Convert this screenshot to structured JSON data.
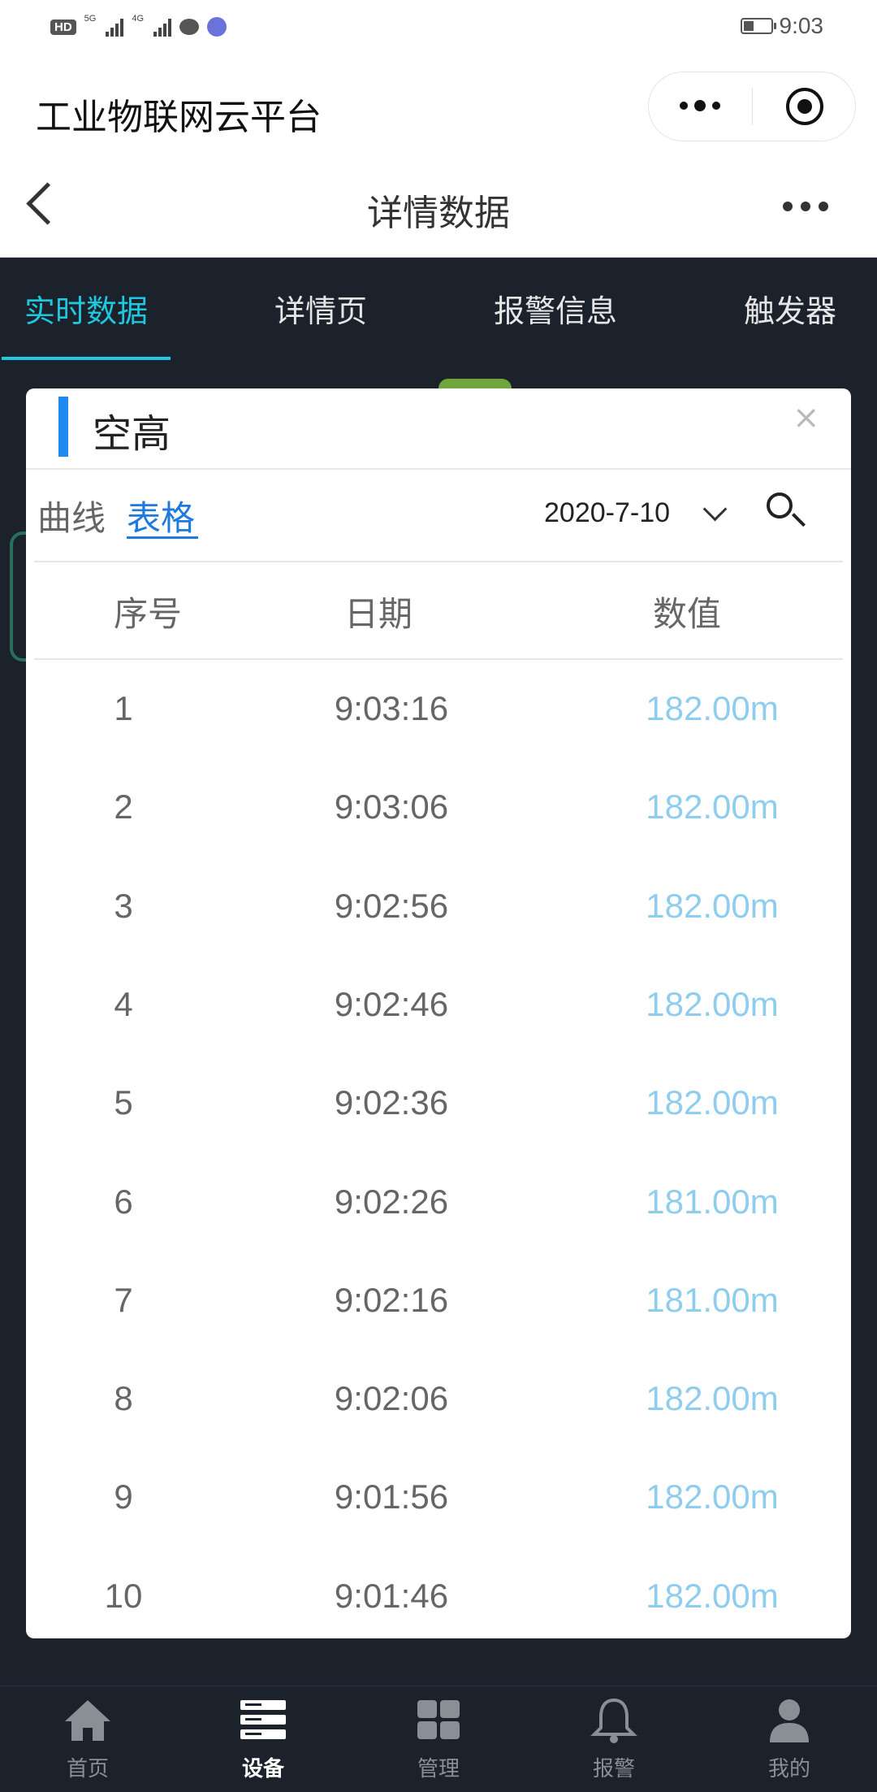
{
  "status_bar": {
    "hd_badge": "HD",
    "sig1_label": "5G",
    "sig2_label": "4G",
    "time": "9:03"
  },
  "app": {
    "title": "工业物联网云平台"
  },
  "nav": {
    "title": "详情数据"
  },
  "tabs": [
    {
      "label": "实时数据",
      "active": true
    },
    {
      "label": "详情页",
      "active": false
    },
    {
      "label": "报警信息",
      "active": false
    },
    {
      "label": "触发器",
      "active": false
    }
  ],
  "modal": {
    "title": "空高",
    "close": "×",
    "mode_curve": "曲线",
    "mode_table": "表格",
    "selected_mode": "表格",
    "date": "2020-7-10",
    "columns": [
      "序号",
      "日期",
      "数值"
    ],
    "rows": [
      {
        "idx": "1",
        "time": "9:03:16",
        "value": "182.00m"
      },
      {
        "idx": "2",
        "time": "9:03:06",
        "value": "182.00m"
      },
      {
        "idx": "3",
        "time": "9:02:56",
        "value": "182.00m"
      },
      {
        "idx": "4",
        "time": "9:02:46",
        "value": "182.00m"
      },
      {
        "idx": "5",
        "time": "9:02:36",
        "value": "182.00m"
      },
      {
        "idx": "6",
        "time": "9:02:26",
        "value": "181.00m"
      },
      {
        "idx": "7",
        "time": "9:02:16",
        "value": "181.00m"
      },
      {
        "idx": "8",
        "time": "9:02:06",
        "value": "182.00m"
      },
      {
        "idx": "9",
        "time": "9:01:56",
        "value": "182.00m"
      },
      {
        "idx": "10",
        "time": "9:01:46",
        "value": "182.00m"
      }
    ]
  },
  "bottom_tabs": [
    {
      "label": "首页",
      "icon": "home-icon",
      "active": false
    },
    {
      "label": "设备",
      "icon": "device-icon",
      "active": true
    },
    {
      "label": "管理",
      "icon": "grid-icon",
      "active": false
    },
    {
      "label": "报警",
      "icon": "bell-icon",
      "active": false
    },
    {
      "label": "我的",
      "icon": "user-icon",
      "active": false
    }
  ],
  "colors": {
    "accent_tab": "#1ec8e0",
    "accent_blue": "#1e7ae0",
    "value_text": "#8fcdee",
    "dark_bg": "#1c222b"
  }
}
